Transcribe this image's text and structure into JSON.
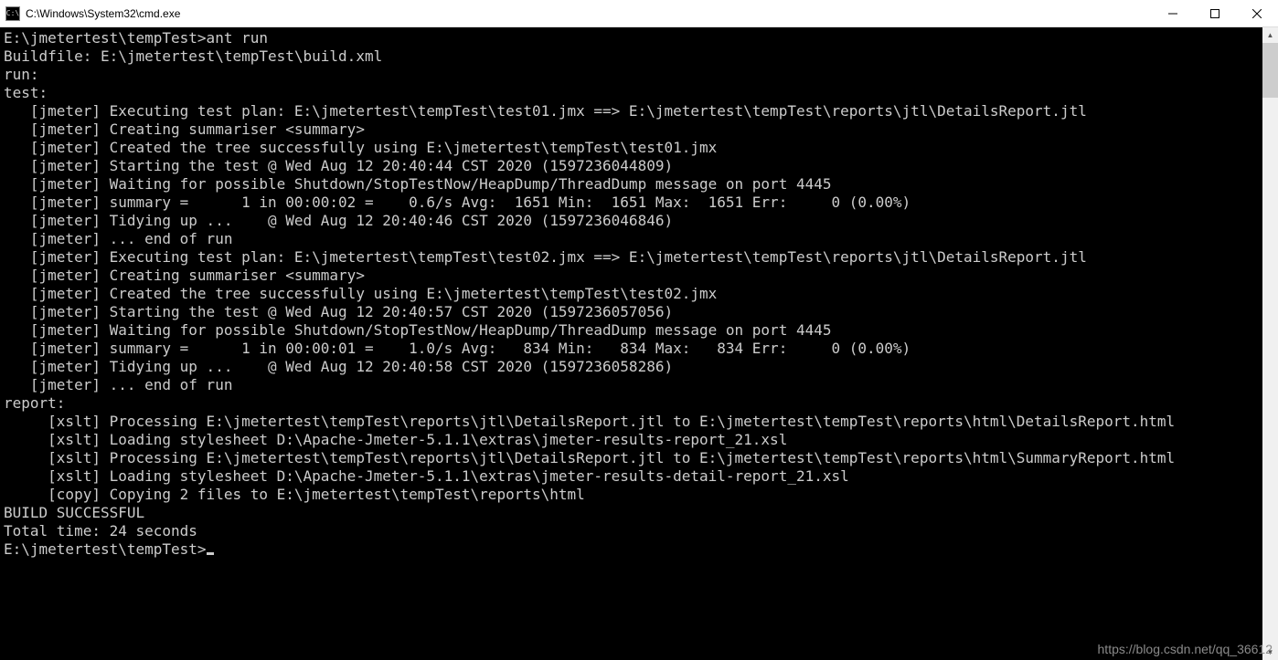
{
  "window": {
    "title": "C:\\Windows\\System32\\cmd.exe",
    "icon_label": "C:\\"
  },
  "terminal": {
    "lines": [
      "E:\\jmetertest\\tempTest>ant run",
      "Buildfile: E:\\jmetertest\\tempTest\\build.xml",
      "",
      "run:",
      "",
      "test:",
      "   [jmeter] Executing test plan: E:\\jmetertest\\tempTest\\test01.jmx ==> E:\\jmetertest\\tempTest\\reports\\jtl\\DetailsReport.jtl",
      "   [jmeter] Creating summariser <summary>",
      "   [jmeter] Created the tree successfully using E:\\jmetertest\\tempTest\\test01.jmx",
      "   [jmeter] Starting the test @ Wed Aug 12 20:40:44 CST 2020 (1597236044809)",
      "   [jmeter] Waiting for possible Shutdown/StopTestNow/HeapDump/ThreadDump message on port 4445",
      "   [jmeter] summary =      1 in 00:00:02 =    0.6/s Avg:  1651 Min:  1651 Max:  1651 Err:     0 (0.00%)",
      "   [jmeter] Tidying up ...    @ Wed Aug 12 20:40:46 CST 2020 (1597236046846)",
      "   [jmeter] ... end of run",
      "   [jmeter] Executing test plan: E:\\jmetertest\\tempTest\\test02.jmx ==> E:\\jmetertest\\tempTest\\reports\\jtl\\DetailsReport.jtl",
      "   [jmeter] Creating summariser <summary>",
      "   [jmeter] Created the tree successfully using E:\\jmetertest\\tempTest\\test02.jmx",
      "   [jmeter] Starting the test @ Wed Aug 12 20:40:57 CST 2020 (1597236057056)",
      "   [jmeter] Waiting for possible Shutdown/StopTestNow/HeapDump/ThreadDump message on port 4445",
      "   [jmeter] summary =      1 in 00:00:01 =    1.0/s Avg:   834 Min:   834 Max:   834 Err:     0 (0.00%)",
      "   [jmeter] Tidying up ...    @ Wed Aug 12 20:40:58 CST 2020 (1597236058286)",
      "   [jmeter] ... end of run",
      "",
      "report:",
      "     [xslt] Processing E:\\jmetertest\\tempTest\\reports\\jtl\\DetailsReport.jtl to E:\\jmetertest\\tempTest\\reports\\html\\DetailsReport.html",
      "     [xslt] Loading stylesheet D:\\Apache-Jmeter-5.1.1\\extras\\jmeter-results-report_21.xsl",
      "     [xslt] Processing E:\\jmetertest\\tempTest\\reports\\jtl\\DetailsReport.jtl to E:\\jmetertest\\tempTest\\reports\\html\\SummaryReport.html",
      "     [xslt] Loading stylesheet D:\\Apache-Jmeter-5.1.1\\extras\\jmeter-results-detail-report_21.xsl",
      "     [copy] Copying 2 files to E:\\jmetertest\\tempTest\\reports\\html",
      "",
      "BUILD SUCCESSFUL",
      "Total time: 24 seconds",
      "",
      "E:\\jmetertest\\tempTest>"
    ]
  },
  "watermark": "https://blog.csdn.net/qq_36612"
}
